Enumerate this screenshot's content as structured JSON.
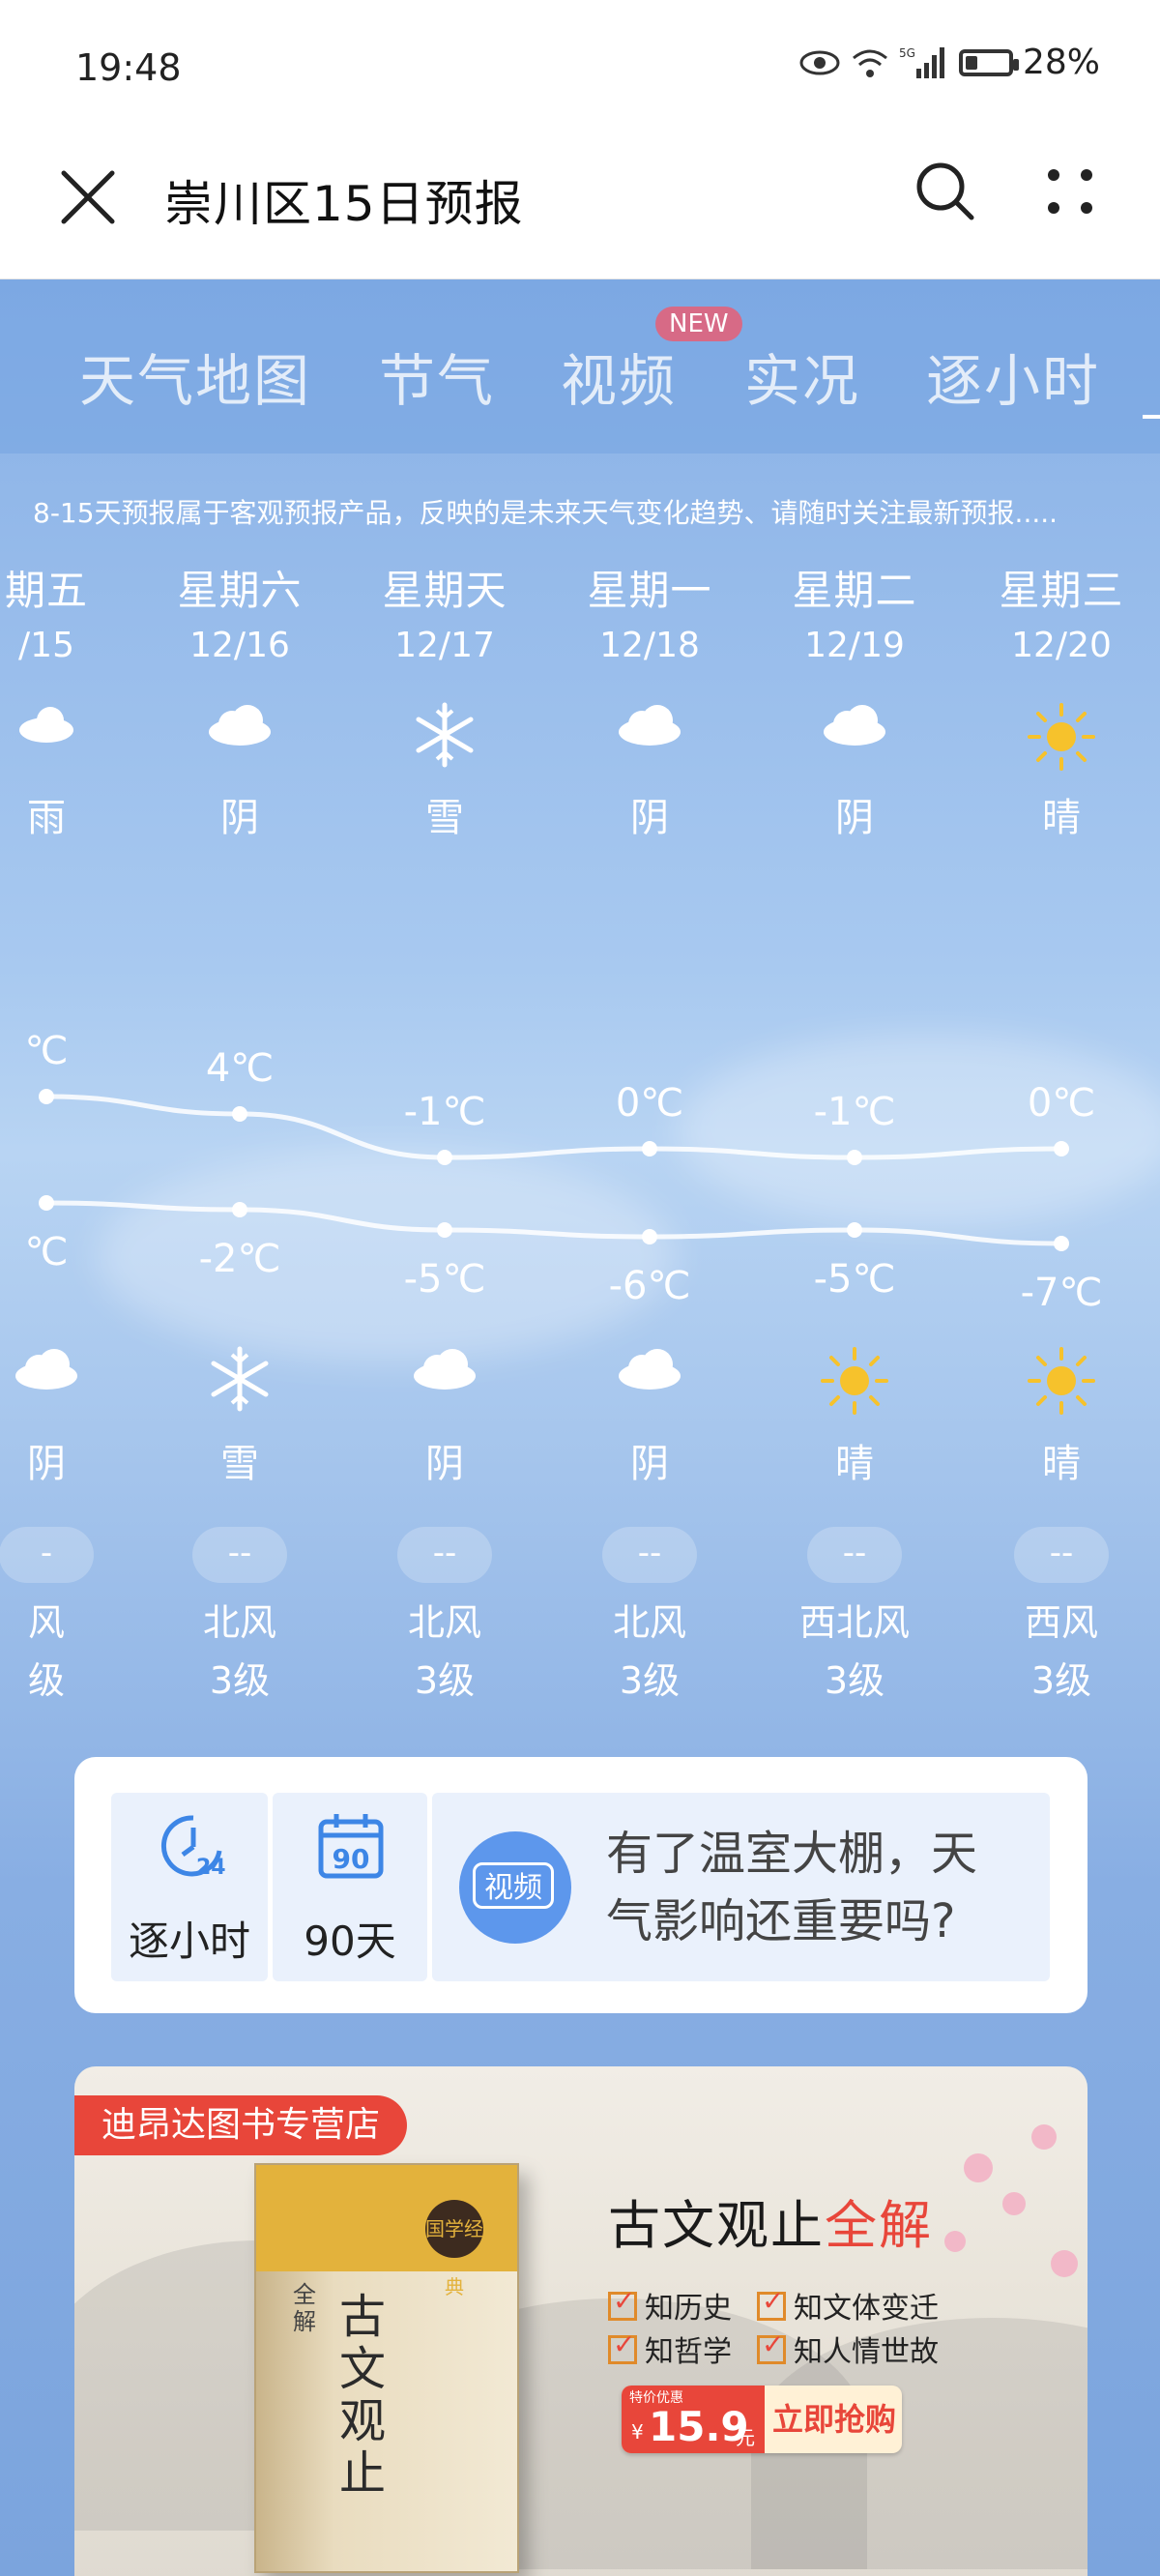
{
  "status_bar": {
    "time": "19:48",
    "battery_percent": "28%",
    "battery_level": 0.28
  },
  "header": {
    "title": "崇川区15日预报"
  },
  "tabs": [
    {
      "label": "天气地图"
    },
    {
      "label": "节气"
    },
    {
      "label": "视频",
      "badge": "NEW"
    },
    {
      "label": "实况"
    },
    {
      "label": "逐小时"
    }
  ],
  "notice": "8-15天预报属于客观预报产品，反映的是未来天气变化趋势、请随时关注最新预报.....",
  "days": [
    {
      "weekday": "期五",
      "date": "/15",
      "day_icon": "rain-icon",
      "day_weather": "雨",
      "high": "℃",
      "low": "℃",
      "high_value": 6,
      "low_value": -1,
      "night_icon": "cloud-icon",
      "night_weather": "阴",
      "aqi": "-",
      "wind_dir": "风",
      "wind_level": "级"
    },
    {
      "weekday": "星期六",
      "date": "12/16",
      "day_icon": "cloud-icon",
      "day_weather": "阴",
      "high": "4℃",
      "low": "-2℃",
      "high_value": 4,
      "low_value": -2,
      "night_icon": "snow-icon",
      "night_weather": "雪",
      "aqi": "--",
      "wind_dir": "北风",
      "wind_level": "3级"
    },
    {
      "weekday": "星期天",
      "date": "12/17",
      "day_icon": "snow-icon",
      "day_weather": "雪",
      "high": "-1℃",
      "low": "-5℃",
      "high_value": -1,
      "low_value": -5,
      "night_icon": "cloud-icon",
      "night_weather": "阴",
      "aqi": "--",
      "wind_dir": "北风",
      "wind_level": "3级"
    },
    {
      "weekday": "星期一",
      "date": "12/18",
      "day_icon": "cloud-icon",
      "day_weather": "阴",
      "high": "0℃",
      "low": "-6℃",
      "high_value": 0,
      "low_value": -6,
      "night_icon": "cloud-icon",
      "night_weather": "阴",
      "aqi": "--",
      "wind_dir": "北风",
      "wind_level": "3级"
    },
    {
      "weekday": "星期二",
      "date": "12/19",
      "day_icon": "cloud-icon",
      "day_weather": "阴",
      "high": "-1℃",
      "low": "-5℃",
      "high_value": -1,
      "low_value": -5,
      "night_icon": "sun-icon",
      "night_weather": "晴",
      "aqi": "--",
      "wind_dir": "西北风",
      "wind_level": "3级"
    },
    {
      "weekday": "星期三",
      "date": "12/20",
      "day_icon": "sun-icon",
      "day_weather": "晴",
      "high": "0℃",
      "low": "-7℃",
      "high_value": 0,
      "low_value": -7,
      "night_icon": "sun-icon",
      "night_weather": "晴",
      "aqi": "--",
      "wind_dir": "西风",
      "wind_level": "3级"
    }
  ],
  "shortcuts": {
    "hourly": {
      "label": "逐小时",
      "icon_text": "24"
    },
    "ninety": {
      "label": "90天",
      "icon_text": "90"
    },
    "video": {
      "badge": "视频",
      "text": "有了温室大棚，天气影响还重要吗?"
    }
  },
  "ad": {
    "store": "迪昂达图书专营店",
    "title_main": "古文观止",
    "title_highlight": "全解",
    "features": [
      "知历史",
      "知文体变迁",
      "知哲学",
      "知人情世故"
    ],
    "book_title": "古文观止",
    "book_sub": "全解",
    "book_logo": "国学经典",
    "price_pre": "特价优惠",
    "currency": "¥",
    "price": "15.9",
    "price_unit": "元",
    "buy_label": "立即抢购"
  },
  "colors": {
    "new_badge": "#d76a86",
    "sun": "#f6c22c",
    "ad_red": "#e8463a",
    "accent_blue": "#5d97ec"
  }
}
